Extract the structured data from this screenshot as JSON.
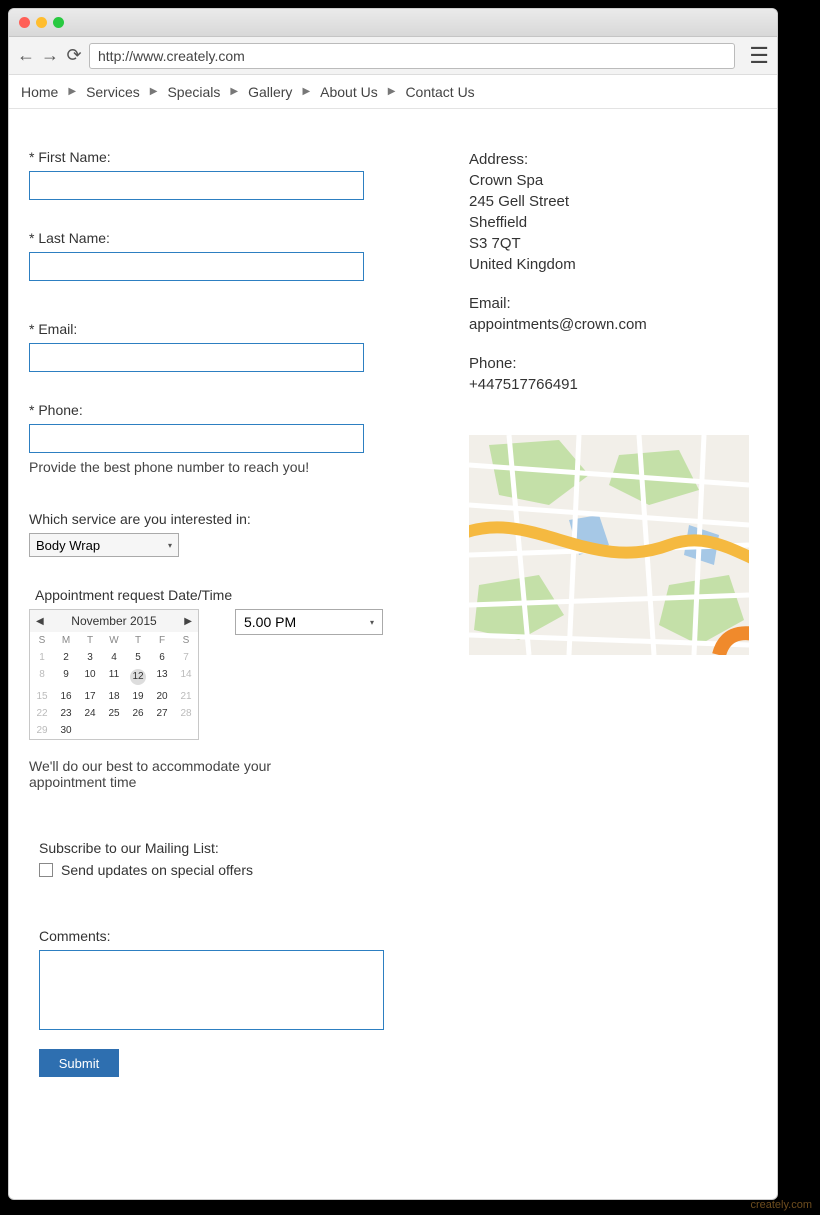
{
  "browser": {
    "url": "http://www.creately.com"
  },
  "nav": {
    "items": [
      "Home",
      "Services",
      "Specials",
      "Gallery",
      "About Us",
      "Contact Us"
    ]
  },
  "form": {
    "first_name": {
      "label": "* First Name:"
    },
    "last_name": {
      "label": "* Last Name:"
    },
    "email": {
      "label": "* Email:"
    },
    "phone": {
      "label": "* Phone:",
      "hint": "Provide the best phone number to reach you!"
    },
    "service": {
      "label": "Which service are you interested in:",
      "selected": "Body Wrap"
    },
    "appointment": {
      "label": "Appointment request Date/Time",
      "time_selected": "5.00 PM",
      "hint": "We'll do our best to accommodate your appointment time"
    },
    "calendar": {
      "title": "November 2015",
      "dow": [
        "S",
        "M",
        "T",
        "W",
        "T",
        "F",
        "S"
      ],
      "weeks": [
        [
          {
            "d": "1",
            "m": true
          },
          {
            "d": "2"
          },
          {
            "d": "3"
          },
          {
            "d": "4"
          },
          {
            "d": "5"
          },
          {
            "d": "6"
          },
          {
            "d": "7",
            "m": true
          }
        ],
        [
          {
            "d": "8",
            "m": true
          },
          {
            "d": "9"
          },
          {
            "d": "10"
          },
          {
            "d": "11"
          },
          {
            "d": "12",
            "sel": true
          },
          {
            "d": "13"
          },
          {
            "d": "14",
            "m": true
          }
        ],
        [
          {
            "d": "15",
            "m": true
          },
          {
            "d": "16"
          },
          {
            "d": "17"
          },
          {
            "d": "18"
          },
          {
            "d": "19"
          },
          {
            "d": "20"
          },
          {
            "d": "21",
            "m": true
          }
        ],
        [
          {
            "d": "22",
            "m": true
          },
          {
            "d": "23"
          },
          {
            "d": "24"
          },
          {
            "d": "25"
          },
          {
            "d": "26"
          },
          {
            "d": "27"
          },
          {
            "d": "28",
            "m": true
          }
        ],
        [
          {
            "d": "29",
            "m": true
          },
          {
            "d": "30"
          },
          {
            "d": ""
          },
          {
            "d": ""
          },
          {
            "d": ""
          },
          {
            "d": ""
          },
          {
            "d": ""
          }
        ]
      ]
    },
    "mailing": {
      "label": "Subscribe to our Mailing List:",
      "option": "Send updates on special offers"
    },
    "comments": {
      "label": "Comments:"
    },
    "submit_label": "Submit"
  },
  "info": {
    "address_label": "Address:",
    "address_lines": [
      "Crown Spa",
      "245 Gell Street",
      "Sheffield",
      "S3 7QT",
      "United Kingdom"
    ],
    "email_label": "Email:",
    "email_value": "appointments@crown.com",
    "phone_label": "Phone:",
    "phone_value": "+447517766491"
  },
  "watermark": "creately.com"
}
